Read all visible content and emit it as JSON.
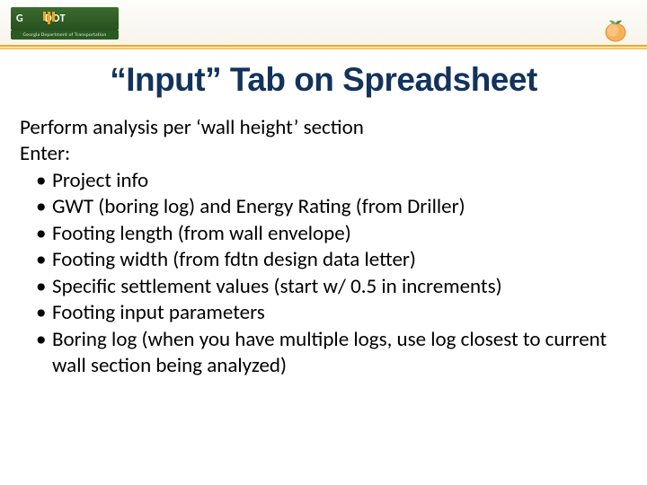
{
  "header": {
    "logo_text": "G",
    "logo_suffix": "DOT",
    "logo_sub": "Georgia Department of Transportation",
    "peach_icon": "peach-icon"
  },
  "title": "“Input” Tab on Spreadsheet",
  "body": {
    "lead1": "Perform analysis per ‘wall height’ section",
    "lead2": "Enter:",
    "bullets": [
      "Project info",
      "GWT (boring log) and Energy Rating (from Driller)",
      "Footing length (from wall envelope)",
      "Footing width (from fdtn design data letter)",
      "Specific settlement values (start w/ 0.5 in increments)",
      "Footing input parameters",
      "Boring log (when you have multiple logs, use log closest to current wall section being analyzed)"
    ]
  }
}
